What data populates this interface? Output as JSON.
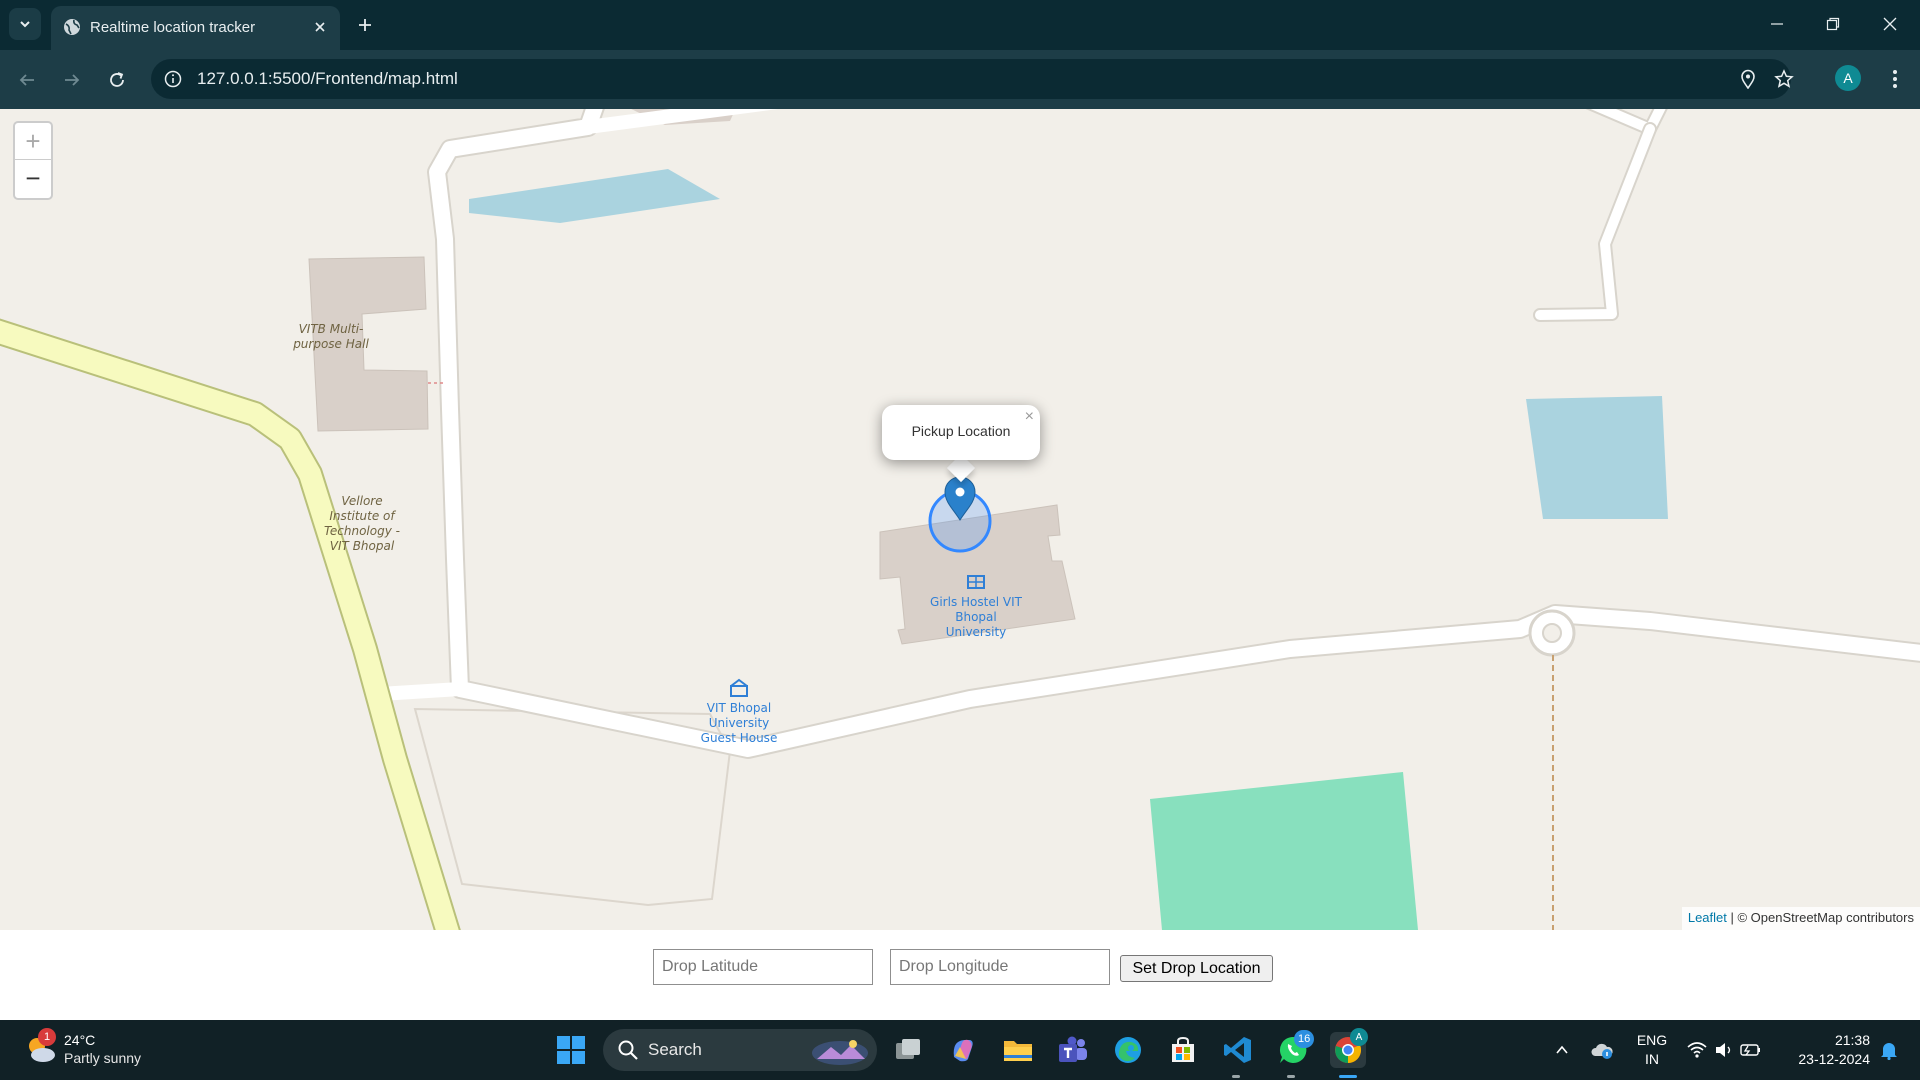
{
  "browser": {
    "tab_title": "Realtime location tracker",
    "url": "127.0.0.1:5500/Frontend/map.html",
    "profile_initial": "A"
  },
  "map": {
    "zoom_in": "+",
    "zoom_out": "−",
    "labels": {
      "hall": "VITB Multi-purpose Hall",
      "institute": "Vellore Institute of Technology - VIT Bhopal",
      "girls_hostel": "Girls Hostel VIT Bhopal University",
      "guest_house": "VIT Bhopal University Guest House"
    },
    "popup_text": "Pickup Location",
    "popup_close": "×",
    "attribution_link": "Leaflet",
    "attribution_text": " | © OpenStreetMap contributors"
  },
  "form": {
    "lat_placeholder": "Drop Latitude",
    "lng_placeholder": "Drop Longitude",
    "submit_label": "Set Drop Location"
  },
  "taskbar": {
    "weather_temp": "24°C",
    "weather_cond": "Partly sunny",
    "weather_badge": "1",
    "search_label": "Search",
    "whatsapp_badge": "16",
    "lang_line1": "ENG",
    "lang_line2": "IN",
    "time": "21:38",
    "date": "23-12-2024"
  },
  "colors": {
    "chrome_dark": "#0b2a33",
    "chrome_toolbar": "#1d3d47",
    "map_background": "#f2efe9",
    "road_primary": "#f7fabf",
    "water": "#aad3df",
    "building": "#d9d0c9",
    "park": "#88e0be",
    "marker": "#2a81cb",
    "taskbar": "#112126"
  }
}
